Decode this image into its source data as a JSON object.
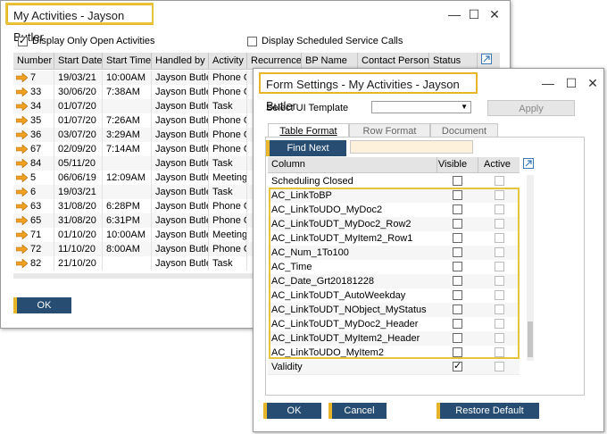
{
  "activities_window": {
    "title": "My Activities - Jayson Butler",
    "display_open_label": "Display Only Open Activities",
    "display_open_checked": true,
    "display_scheduled_label": "Display Scheduled Service Calls",
    "display_scheduled_checked": false,
    "columns": [
      "Number",
      "Start Date",
      "Start Time",
      "Handled by",
      "Activity",
      "Recurrence",
      "BP Name",
      "Contact Person",
      "Status"
    ],
    "rows": [
      [
        "7",
        "19/03/21",
        "10:00AM",
        "Jayson Butler",
        "Phone Ca"
      ],
      [
        "33",
        "30/06/20",
        "7:38AM",
        "Jayson Butler",
        "Phone Ca"
      ],
      [
        "34",
        "01/07/20",
        "",
        "Jayson Butler",
        "Task"
      ],
      [
        "35",
        "01/07/20",
        "7:26AM",
        "Jayson Butler",
        "Phone Ca"
      ],
      [
        "36",
        "03/07/20",
        "3:29AM",
        "Jayson Butler",
        "Phone Ca"
      ],
      [
        "67",
        "02/09/20",
        "7:14AM",
        "Jayson Butler",
        "Phone Ca"
      ],
      [
        "84",
        "05/11/20",
        "",
        "Jayson Butler",
        "Task"
      ],
      [
        "5",
        "06/06/19",
        "12:09AM",
        "Jayson Butler",
        "Meeting"
      ],
      [
        "6",
        "19/03/21",
        "",
        "Jayson Butler",
        "Task"
      ],
      [
        "63",
        "31/08/20",
        "6:28PM",
        "Jayson Butler",
        "Phone Ca"
      ],
      [
        "65",
        "31/08/20",
        "6:31PM",
        "Jayson Butler",
        "Phone Ca"
      ],
      [
        "71",
        "01/10/20",
        "10:00AM",
        "Jayson Butler",
        "Meeting"
      ],
      [
        "72",
        "11/10/20",
        "8:00AM",
        "Jayson Butler",
        "Phone Ca"
      ],
      [
        "82",
        "21/10/20",
        "",
        "Jayson Butler",
        "Task"
      ]
    ],
    "ok_label": "OK"
  },
  "form_settings": {
    "title": "Form Settings - My Activities - Jayson Butler",
    "select_template_label": "Select UI Template",
    "select_template_value": "",
    "apply_label": "Apply",
    "tabs": [
      "Table Format",
      "Row Format",
      "Document"
    ],
    "find_next_label": "Find Next",
    "find_value": "",
    "columns": {
      "column": "Column",
      "visible": "Visible",
      "active": "Active"
    },
    "rows": [
      {
        "name": "Scheduling Closed",
        "visible": false
      },
      {
        "name": "AC_LinkToBP",
        "visible": false
      },
      {
        "name": "AC_LinkToUDO_MyDoc2",
        "visible": false
      },
      {
        "name": "AC_LinkToUDT_MyDoc2_Row2",
        "visible": false
      },
      {
        "name": "AC_LinkToUDT_MyItem2_Row1",
        "visible": false
      },
      {
        "name": "AC_Num_1To100",
        "visible": false
      },
      {
        "name": "AC_Time",
        "visible": false
      },
      {
        "name": "AC_Date_Grt20181228",
        "visible": false
      },
      {
        "name": "AC_LinkToUDT_AutoWeekday",
        "visible": false
      },
      {
        "name": "AC_LinkToUDT_NObject_MyStatus",
        "visible": false
      },
      {
        "name": "AC_LinkToUDT_MyDoc2_Header",
        "visible": false
      },
      {
        "name": "AC_LinkToUDT_MyItem2_Header",
        "visible": false
      },
      {
        "name": "AC_LinkToUDO_MyItem2",
        "visible": false
      },
      {
        "name": "Validity",
        "visible": true
      }
    ],
    "ok_label": "OK",
    "cancel_label": "Cancel",
    "restore_label": "Restore Default"
  },
  "colors": {
    "highlight": "#e8b52a",
    "button": "#274d72",
    "arrow": "#f0a020"
  }
}
